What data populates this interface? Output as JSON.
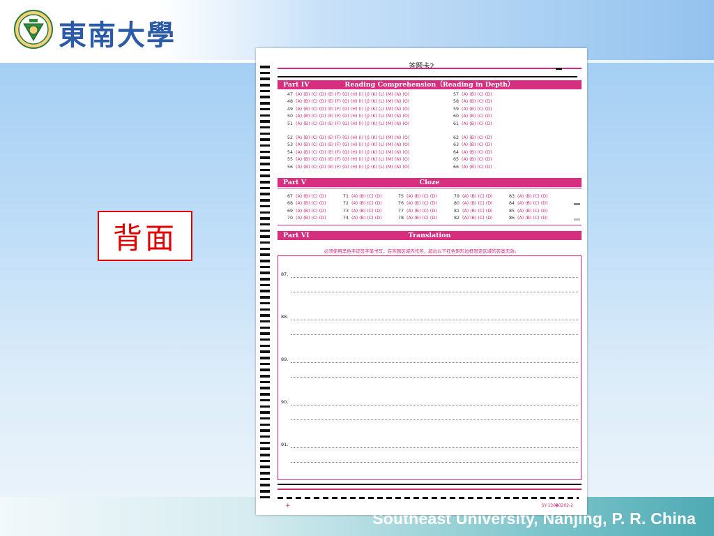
{
  "header": {
    "brand": "東南大學"
  },
  "footer": {
    "text": "Southeast University, Nanjing, P. R. China"
  },
  "label": {
    "text": "背面"
  },
  "sheet": {
    "title": "答题卡2",
    "code": "SY-13030202-2",
    "part4": {
      "name": "Part IV",
      "title": "Reading Comprehension（Reading  in  Depth）"
    },
    "part5": {
      "name": "Part V",
      "title": "Cloze"
    },
    "part6": {
      "name": "Part VI",
      "title": "Translation"
    },
    "notice": "必须使用黑色字迹签字笔书写，在答题区域内作答，超出以下红色矩形边框限定区域的答案无效。",
    "long_options": "(A) (B) (C) (D) (E) (F) (G) (H) (I) (J) (K) (L) (M) (N) (O)",
    "short_options": "(A) (B) (C) (D)",
    "part4_long": [
      "47",
      "48",
      "49",
      "50",
      "51",
      "52",
      "53",
      "54",
      "55",
      "56"
    ],
    "part4_short": [
      "57",
      "58",
      "59",
      "60",
      "61",
      "62",
      "63",
      "64",
      "65",
      "66"
    ],
    "cloze_cols": [
      [
        "67",
        "68",
        "69",
        "70"
      ],
      [
        "71",
        "72",
        "73",
        "74"
      ],
      [
        "75",
        "76",
        "77",
        "78"
      ],
      [
        "79",
        "80",
        "81",
        "82"
      ],
      [
        "83",
        "84",
        "85",
        "86"
      ]
    ],
    "translation": [
      "87.",
      "88.",
      "89.",
      "90.",
      "91."
    ]
  },
  "colors": {
    "accent": "#d82e80",
    "label_red": "#e00000",
    "brand_blue": "#2a5aa8"
  }
}
